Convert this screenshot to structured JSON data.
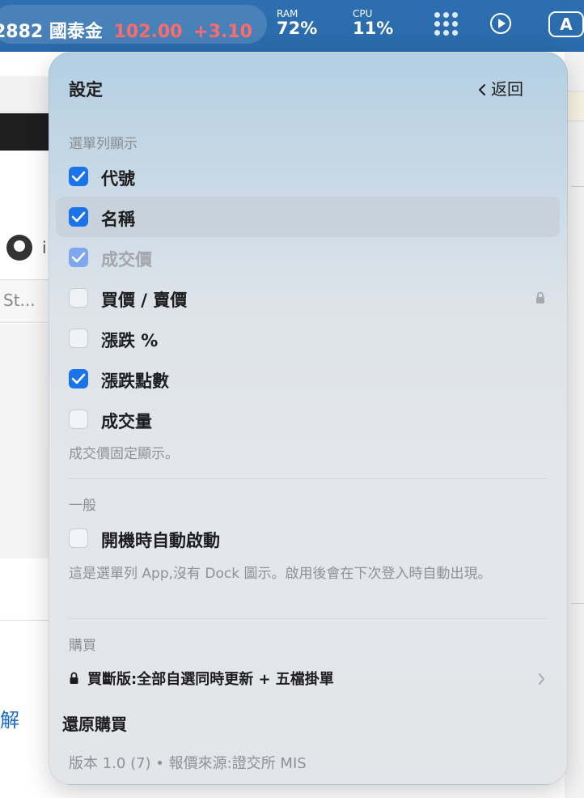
{
  "menubar": {
    "ticker_code": "2882",
    "ticker_name": "國泰金",
    "ticker_price": "102.00",
    "ticker_change": "+3.10",
    "ram_label": "RAM",
    "ram_value": "72%",
    "cpu_label": "CPU",
    "cpu_value": "11%",
    "input_source": "A",
    "icons": [
      "grid-dots-icon",
      "play-circle-icon",
      "input-source-icon"
    ]
  },
  "background_app": {
    "partial_i": "i",
    "search_placeholder": "St...",
    "link_partial": "解",
    "icons": [
      "github-icon"
    ]
  },
  "settings": {
    "title": "設定",
    "back_label": "返回",
    "menubar_section": "選單列顯示",
    "options": [
      {
        "label": "代號",
        "checked": true
      },
      {
        "label": "名稱",
        "checked": true
      },
      {
        "label": "成交價",
        "checked": true
      },
      {
        "label": "買價 / 賣價",
        "checked": false
      },
      {
        "label": "漲跌 %",
        "checked": false
      },
      {
        "label": "漲跌點數",
        "checked": true
      },
      {
        "label": "成交量",
        "checked": false
      }
    ],
    "fixed_note": "成交價固定顯示。",
    "general_section": "一般",
    "launch_at_login": {
      "label": "開機時自動啟動",
      "checked": false
    },
    "launch_note": "這是選單列 App,沒有 Dock 圖示。啟用後會在下次登入時自動出現。",
    "purchase_section": "購買",
    "purchase_item": "買斷版:全部自選同時更新 + 五檔掛單",
    "restore_label": "還原購買",
    "footer": "版本 1.0 (7) • 報價來源:證交所 MIS"
  },
  "colors": {
    "accent": "#1a73e8",
    "menubar_bg": "#2d6fb0",
    "price_up": "#ff6b6b"
  }
}
